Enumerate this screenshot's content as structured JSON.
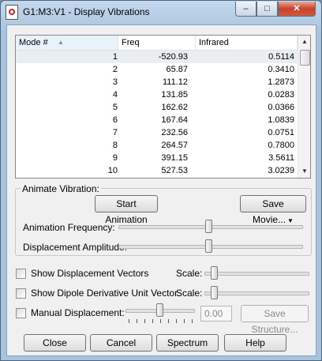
{
  "window": {
    "title": "G1:M3:V1 - Display Vibrations"
  },
  "table": {
    "columns": [
      "Mode #",
      "Freq",
      "Infrared"
    ],
    "rows": [
      {
        "mode": "1",
        "freq": "-520.93",
        "ir": "0.5114"
      },
      {
        "mode": "2",
        "freq": "65.87",
        "ir": "0.3410"
      },
      {
        "mode": "3",
        "freq": "111.12",
        "ir": "1.2873"
      },
      {
        "mode": "4",
        "freq": "131.85",
        "ir": "0.0283"
      },
      {
        "mode": "5",
        "freq": "162.62",
        "ir": "0.0366"
      },
      {
        "mode": "6",
        "freq": "167.64",
        "ir": "1.0839"
      },
      {
        "mode": "7",
        "freq": "232.56",
        "ir": "0.0751"
      },
      {
        "mode": "8",
        "freq": "264.57",
        "ir": "0.7800"
      },
      {
        "mode": "9",
        "freq": "391.15",
        "ir": "3.5611"
      },
      {
        "mode": "10",
        "freq": "527.53",
        "ir": "3.0239"
      }
    ]
  },
  "animate": {
    "group_label": "Animate Vibration:",
    "start_button": "Start Animation",
    "save_movie_button": "Save Movie...",
    "frequency_label": "Animation Frequency:",
    "frequency_value": 0.78,
    "amplitude_label": "Displacement Amplitude:",
    "amplitude_value": 0.5
  },
  "options": {
    "show_displacement_vectors": "Show Displacement Vectors",
    "show_dipole": "Show Dipole Derivative Unit Vector",
    "manual_displacement": "Manual Displacement:",
    "scale_label": "Scale:",
    "manual_value": "0.00",
    "manual_slider_value": 0.5,
    "save_structure_button": "Save Structure..."
  },
  "buttons": {
    "close": "Close",
    "cancel": "Cancel",
    "spectrum": "Spectrum",
    "help": "Help"
  }
}
